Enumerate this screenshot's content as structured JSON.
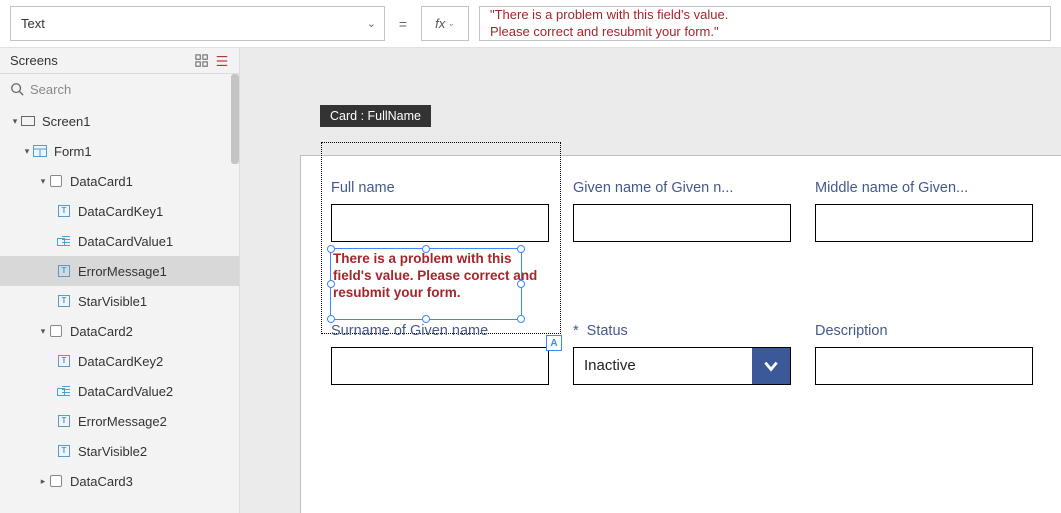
{
  "formula_bar": {
    "property": "Text",
    "equals": "=",
    "fx": "fx",
    "value_line1": "\"There is a problem with this field's value.",
    "value_line2": "Please correct and resubmit your form.\""
  },
  "sidebar": {
    "title": "Screens",
    "search_placeholder": "Search",
    "tree": {
      "screen1": "Screen1",
      "form1": "Form1",
      "dc1": "DataCard1",
      "dck1": "DataCardKey1",
      "dcv1": "DataCardValue1",
      "err1": "ErrorMessage1",
      "sv1": "StarVisible1",
      "dc2": "DataCard2",
      "dck2": "DataCardKey2",
      "dcv2": "DataCardValue2",
      "err2": "ErrorMessage2",
      "sv2": "StarVisible2",
      "dc3": "DataCard3"
    }
  },
  "canvas": {
    "selected_card_tag": "Card : FullName",
    "accessibility_tag": "A",
    "fields": {
      "fullname": {
        "label": "Full name",
        "error": "There is a problem with this field's value.  Please correct and resubmit your form."
      },
      "given": {
        "label": "Given name of Given n..."
      },
      "middle": {
        "label": "Middle name of Given..."
      },
      "surname": {
        "label": "Surname of Given name"
      },
      "status": {
        "label": "Status",
        "required": "*",
        "value": "Inactive"
      },
      "desc": {
        "label": "Description"
      }
    }
  }
}
